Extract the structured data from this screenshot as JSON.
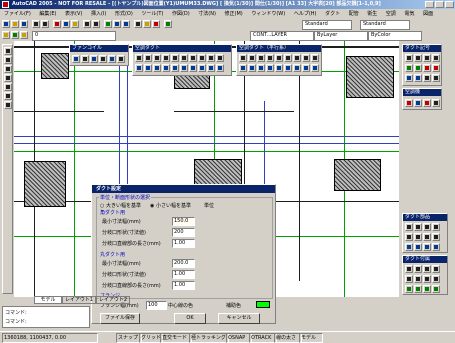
{
  "window": {
    "title": "AutoCAD 2005 - NOT FOR RESALE - [(トヤンプル)図面位置(Y1)UMUM33.DWG] [ 換気(1/30)] 間仕(1/30)] [A1 33] 大宇表[20] 部品欠損[1-1,0,9]"
  },
  "menu": [
    "ファイル(F)",
    "編集(E)",
    "表示(V)",
    "挿入(I)",
    "形式(O)",
    "ツール(T)",
    "作図(D)",
    "寸法(N)",
    "修正(M)",
    "ウィンドウ(W)",
    "ヘルプ(H)",
    "ダクト",
    "配管",
    "衛生",
    "空調",
    "電気",
    "図面"
  ],
  "toolbar": {
    "style_combo1": "Standard",
    "style_combo2": "Standard",
    "layer_combo": "0",
    "linetype_combo": "CONT...LAYER",
    "lineweight_combo": "ByLayer",
    "color_combo": "ByColor"
  },
  "palettes": {
    "p1_title": "ファンコイル",
    "p2_title": "空調ダクト",
    "p3_title": "空調ダクト（平行系）",
    "p4_title": "ダクト記号",
    "p5_title": "空調機",
    "p6_title": "ダクト部品",
    "p7_title": "ダクト付属"
  },
  "tabs": [
    "モデル",
    "レイアウト1",
    "レイアウト2"
  ],
  "command_lines": [
    "コマンド:",
    "コマンド:"
  ],
  "status": {
    "coords": "1360188, 1100437, 0.00",
    "items": [
      "スナップ",
      "グリッド",
      "直交モード",
      "極トラッキング",
      "OSNAP",
      "OTRACK",
      "線の太さ",
      "モデル"
    ]
  },
  "dialog": {
    "title": "ダクト設定",
    "group_main": "単位・断面形状の選択",
    "radio1": "大きい幅を基準",
    "radio2": "小さい幅を基準",
    "group_sub1": "角ダクト用",
    "label_a1": "最小寸法幅(mm)",
    "label_a2": "分岐口形状(寸法値)",
    "label_a3": "分岐口直線部の長さ(mm)",
    "value_a1": "150.0",
    "value_a2": "200",
    "value_a3": "1.00",
    "group_sub2": "丸ダクト用",
    "label_b1": "最小寸法幅(mm)",
    "label_b2": "分岐口形状(寸法値)",
    "label_b3": "分岐口直線部の長さ(mm)",
    "value_b1": "200.0",
    "value_b2": "1.00",
    "value_b3": "1.00",
    "group_flange": "フランジ",
    "flange_label": "フランジ幅(mm)",
    "flange_value": "100",
    "center_line_label": "中心線の色",
    "fill_label": "補助色",
    "fill_color": "#00ff00",
    "btn_save": "ファイル保存",
    "btn_ok": "OK",
    "btn_cancel": "キャンセル",
    "unit_label": "単位"
  }
}
